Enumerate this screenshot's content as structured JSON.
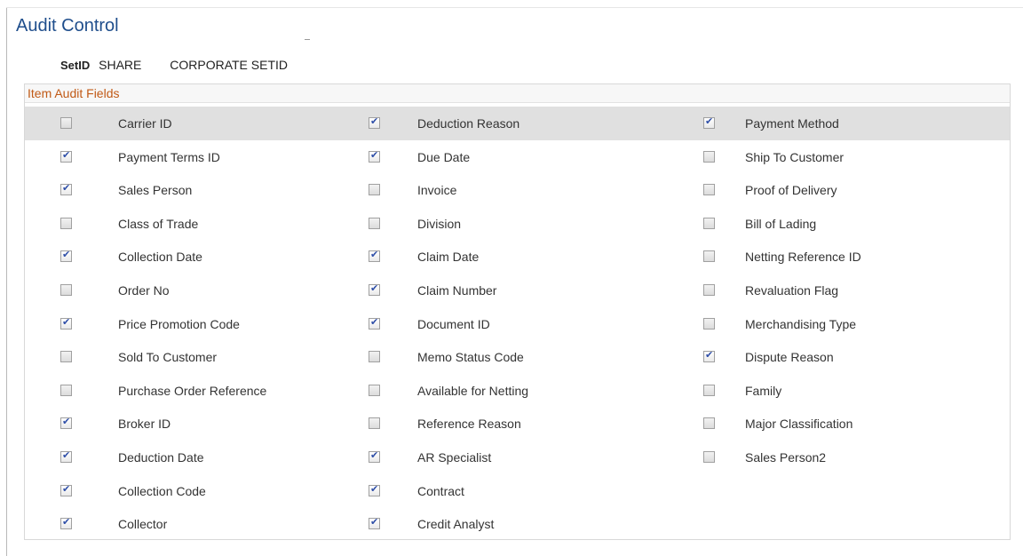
{
  "page": {
    "title": "Audit Control"
  },
  "setid": {
    "label": "SetID",
    "value": "SHARE",
    "description": "CORPORATE SETID"
  },
  "group": {
    "title": "Item Audit Fields"
  },
  "rows": [
    [
      {
        "label": "Carrier ID",
        "checked": false
      },
      {
        "label": "Deduction Reason",
        "checked": true
      },
      {
        "label": "Payment Method",
        "checked": true
      }
    ],
    [
      {
        "label": "Payment Terms ID",
        "checked": true
      },
      {
        "label": "Due Date",
        "checked": true
      },
      {
        "label": "Ship To Customer",
        "checked": false
      }
    ],
    [
      {
        "label": "Sales Person",
        "checked": true
      },
      {
        "label": "Invoice",
        "checked": false
      },
      {
        "label": "Proof of Delivery",
        "checked": false
      }
    ],
    [
      {
        "label": "Class of Trade",
        "checked": false
      },
      {
        "label": "Division",
        "checked": false
      },
      {
        "label": "Bill of Lading",
        "checked": false
      }
    ],
    [
      {
        "label": "Collection Date",
        "checked": true
      },
      {
        "label": "Claim Date",
        "checked": true
      },
      {
        "label": "Netting Reference ID",
        "checked": false
      }
    ],
    [
      {
        "label": "Order No",
        "checked": false
      },
      {
        "label": "Claim Number",
        "checked": true
      },
      {
        "label": "Revaluation Flag",
        "checked": false
      }
    ],
    [
      {
        "label": "Price Promotion Code",
        "checked": true
      },
      {
        "label": "Document ID",
        "checked": true
      },
      {
        "label": "Merchandising Type",
        "checked": false
      }
    ],
    [
      {
        "label": "Sold To Customer",
        "checked": false
      },
      {
        "label": "Memo Status Code",
        "checked": false
      },
      {
        "label": "Dispute Reason",
        "checked": true
      }
    ],
    [
      {
        "label": "Purchase Order Reference",
        "checked": false
      },
      {
        "label": "Available for Netting",
        "checked": false
      },
      {
        "label": "Family",
        "checked": false
      }
    ],
    [
      {
        "label": "Broker ID",
        "checked": true
      },
      {
        "label": "Reference Reason",
        "checked": false
      },
      {
        "label": "Major Classification",
        "checked": false
      }
    ],
    [
      {
        "label": "Deduction Date",
        "checked": true
      },
      {
        "label": "AR Specialist",
        "checked": true
      },
      {
        "label": "Sales Person2",
        "checked": false
      }
    ],
    [
      {
        "label": "Collection Code",
        "checked": true
      },
      {
        "label": "Contract",
        "checked": true
      }
    ],
    [
      {
        "label": "Collector",
        "checked": true
      },
      {
        "label": "Credit Analyst",
        "checked": true
      }
    ]
  ],
  "colors": {
    "title": "#1f4e8c",
    "group_title": "#c15a16",
    "row_highlight": "#e0e0e0",
    "check": "#2f4fa8"
  }
}
